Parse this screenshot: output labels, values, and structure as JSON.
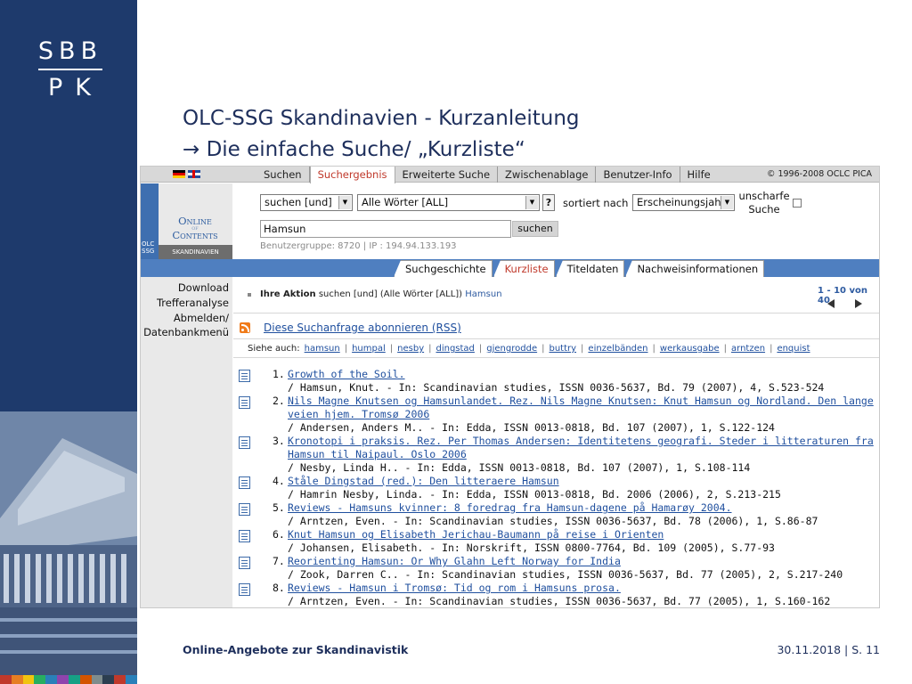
{
  "logo": {
    "line1": "SBB",
    "line2": "PK"
  },
  "slide": {
    "title_line1": "OLC-SSG Skandinavien - Kurzanleitung",
    "title_line2": "→ Die einfache Suche/ „Kurzliste“"
  },
  "catalog": {
    "top_tabs": [
      "Suchen",
      "Suchergebnis",
      "Erweiterte Suche",
      "Zwischenablage",
      "Benutzer-Info",
      "Hilfe"
    ],
    "active_top_tab": "Suchergebnis",
    "copyright": "© 1996-2008 OCLC PICA",
    "olc_logo": {
      "word1": "Online",
      "word_of": "of",
      "word2": "Contents",
      "side_label_1": "OLC",
      "side_label_2": "SSG",
      "sub_label": "SKANDINAVIEN"
    },
    "form": {
      "operator_value": "suchen [und]",
      "field_value": "Alle Wörter [ALL]",
      "help_label": "?",
      "sort_label": "sortiert nach",
      "sort_value": "Erscheinungsjahr",
      "fuzzy_label_1": "unscharfe",
      "fuzzy_label_2": "Suche",
      "query_value": "Hamsun",
      "search_button": "suchen",
      "user_group": "Benutzergruppe: 8720 | IP : 194.94.133.193"
    },
    "sub_tabs": [
      "Suchgeschichte",
      "Kurzliste",
      "Titeldaten",
      "Nachweisinformationen"
    ],
    "active_sub_tab": "Kurzliste",
    "left_menu": [
      "Download",
      "Trefferanalyse",
      "Abmelden/",
      "Datenbankmenü"
    ],
    "action": {
      "label": "Ihre Aktion",
      "text": "suchen [und] (Alle Wörter [ALL])",
      "term": "Hamsun"
    },
    "pager": {
      "range": "1 - 10 von 40"
    },
    "rss_link": "Diese Suchanfrage abonnieren (RSS)",
    "see_also": {
      "label": "Siehe auch:",
      "terms": [
        "hamsun",
        "humpal",
        "nesby",
        "dingstad",
        "gjengrodde",
        "buttry",
        "einzelbänden",
        "werkausgabe",
        "arntzen",
        "enquist"
      ]
    },
    "results": [
      {
        "num": "1.",
        "title": "Growth of the Soil.",
        "meta": "/ Hamsun, Knut. - In: Scandinavian studies, ISSN 0036-5637, Bd. 79 (2007), 4, S.523-524"
      },
      {
        "num": "2.",
        "title": "Nils Magne Knutsen og Hamsunlandet. Rez. Nils Magne Knutsen: Knut Hamsun og Nordland. Den lange veien hjem. Tromsø 2006",
        "meta": "/ Andersen, Anders M.. - In: Edda, ISSN 0013-0818, Bd. 107 (2007), 1, S.122-124"
      },
      {
        "num": "3.",
        "title": "Kronotopi i praksis. Rez. Per Thomas Andersen: Identitetens geografi. Steder i litteraturen fra Hamsun til Naipaul. Oslo 2006",
        "meta": "/ Nesby, Linda H.. - In: Edda, ISSN 0013-0818, Bd. 107 (2007), 1, S.108-114"
      },
      {
        "num": "4.",
        "title": "Ståle Dingstad (red.): Den litteraere Hamsun",
        "meta": "/ Hamrin Nesby, Linda. - In: Edda, ISSN 0013-0818, Bd. 2006 (2006), 2, S.213-215"
      },
      {
        "num": "5.",
        "title": "Reviews - Hamsuns kvinner: 8 foredrag fra Hamsun-dagene på Hamarøy 2004.",
        "meta": "/ Arntzen, Even. - In: Scandinavian studies, ISSN 0036-5637, Bd. 78 (2006), 1, S.86-87"
      },
      {
        "num": "6.",
        "title": "Knut Hamsun og Elisabeth Jerichau-Baumann på reise i Orienten",
        "meta": "/ Johansen, Elisabeth. - In: Norskrift, ISSN 0800-7764, Bd. 109 (2005), S.77-93"
      },
      {
        "num": "7.",
        "title": "Reorienting Hamsun: Or Why Glahn Left Norway for India",
        "meta": "/ Zook, Darren C.. - In: Scandinavian studies, ISSN 0036-5637, Bd. 77 (2005), 2, S.217-240"
      },
      {
        "num": "8.",
        "title": "Reviews - Hamsun i Tromsø: Tid og rom i Hamsuns prosa.",
        "meta": "/ Arntzen, Even. - In: Scandinavian studies, ISSN 0036-5637, Bd. 77 (2005), 1, S.160-162"
      }
    ]
  },
  "footer": {
    "left": "Online-Angebote zur Skandinavistik",
    "right": "30.11.2018 | S. 11"
  },
  "colors": {
    "navy": "#1e3a6c",
    "title": "#1e2f5c",
    "catalog_blue": "#4f7fc0",
    "link": "#1f4f9e",
    "active_tab": "#c0392b"
  }
}
